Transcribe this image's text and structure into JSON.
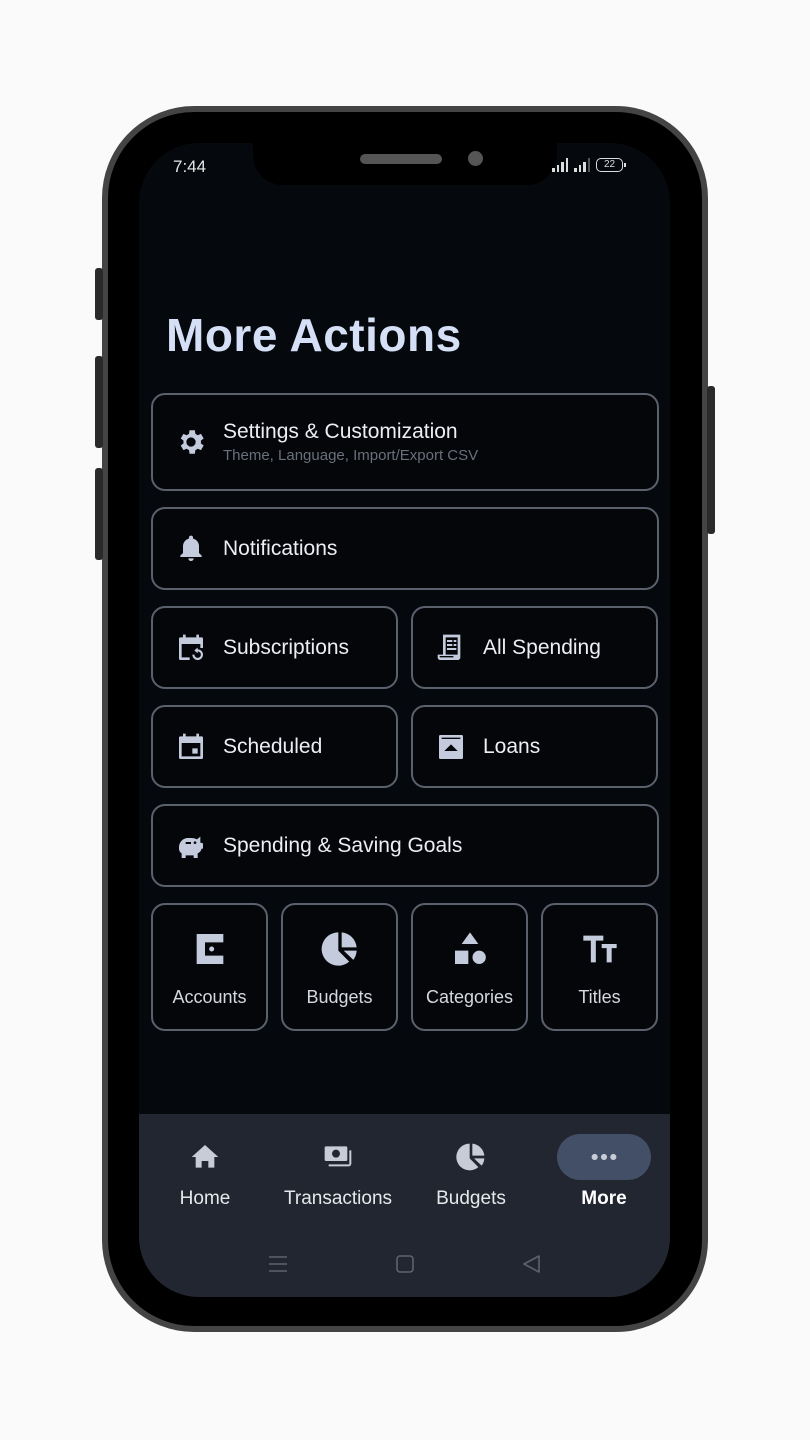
{
  "status_bar": {
    "time": "7:44",
    "battery": "22"
  },
  "page": {
    "title": "More Actions"
  },
  "actions": {
    "settings": {
      "label": "Settings & Customization",
      "subtitle": "Theme, Language, Import/Export CSV",
      "icon": "gear-icon"
    },
    "notifications": {
      "label": "Notifications",
      "icon": "bell-icon"
    },
    "subscriptions": {
      "label": "Subscriptions",
      "icon": "calendar-repeat-icon"
    },
    "all_spending": {
      "label": "All Spending",
      "icon": "receipt-icon"
    },
    "scheduled": {
      "label": "Scheduled",
      "icon": "calendar-event-icon"
    },
    "loans": {
      "label": "Loans",
      "icon": "archive-up-icon"
    },
    "goals": {
      "label": "Spending & Saving Goals",
      "icon": "piggy-bank-icon"
    }
  },
  "tiles": [
    {
      "label": "Accounts",
      "icon": "wallet-icon"
    },
    {
      "label": "Budgets",
      "icon": "pie-chart-icon"
    },
    {
      "label": "Categories",
      "icon": "shapes-icon"
    },
    {
      "label": "Titles",
      "icon": "text-size-icon"
    }
  ],
  "bottom_nav": {
    "items": [
      {
        "label": "Home",
        "icon": "home-icon",
        "active": false
      },
      {
        "label": "Transactions",
        "icon": "money-icon",
        "active": false
      },
      {
        "label": "Budgets",
        "icon": "pie-chart-icon",
        "active": false
      },
      {
        "label": "More",
        "icon": "more-dots-icon",
        "active": true
      }
    ]
  },
  "colors": {
    "background": "#05080d",
    "accent_pill": "#434f66",
    "title": "#d5dff5",
    "border": "#5a616d",
    "nav_bar": "#222630"
  }
}
